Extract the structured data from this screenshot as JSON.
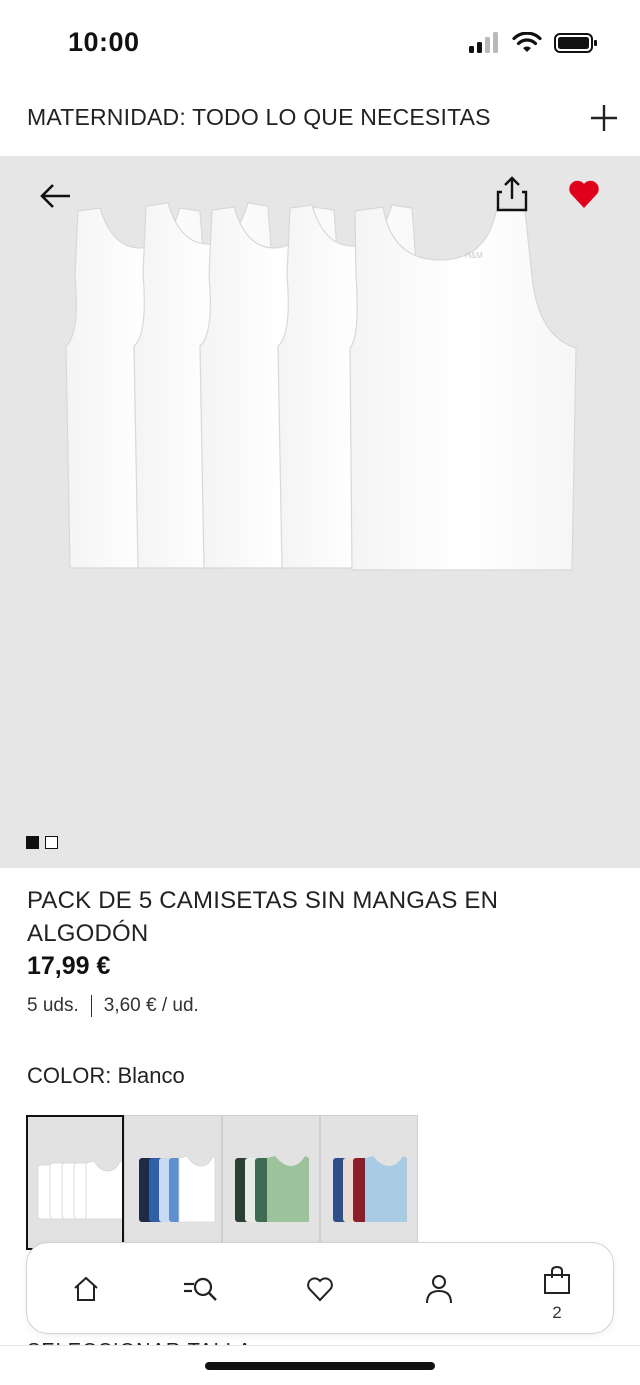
{
  "status_bar": {
    "time": "10:00",
    "icons": [
      "signal-icon",
      "wifi-icon",
      "battery-icon"
    ]
  },
  "promo": {
    "text": "MATERNIDAD: TODO LO QUE NECESITAS",
    "expand_icon": "plus-icon"
  },
  "hero": {
    "icons": [
      "back-arrow-icon",
      "share-icon",
      "heart-icon"
    ],
    "favorite_color": "#e0001b",
    "pager": {
      "total": 2,
      "active": 1
    }
  },
  "product": {
    "title": "PACK DE 5 CAMISETAS SIN MANGAS EN ALGODÓN",
    "price": "17,99 €",
    "units": "5 uds.",
    "unit_price": "3,60 € / ud."
  },
  "color": {
    "label": "COLOR:",
    "value": "Blanco",
    "swatches": [
      {
        "name": "white",
        "selected": true
      },
      {
        "name": "blue-white",
        "selected": false
      },
      {
        "name": "green",
        "selected": false
      },
      {
        "name": "red-blue",
        "selected": false
      }
    ]
  },
  "size_section": {
    "label": "SELECCIONAR TALLA"
  },
  "nav": {
    "items": [
      "home-icon",
      "search-icon",
      "heart-outline-icon",
      "account-icon",
      "bag-icon"
    ],
    "bag_count": "2"
  }
}
